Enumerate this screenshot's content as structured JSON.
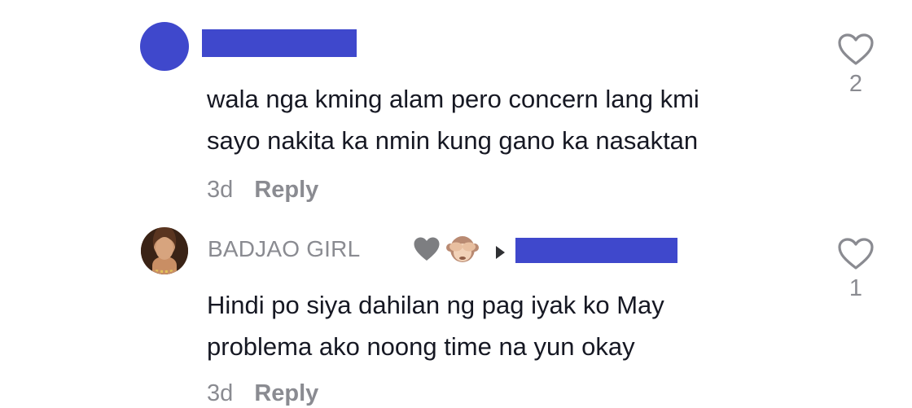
{
  "comments": [
    {
      "avatar": "blue-circle-avatar",
      "username_redacted": true,
      "text_lines": [
        "wala nga kming alam pero concern lang kmi",
        "sayo nakita ka nmin kung gano ka nasaktan"
      ],
      "time": "3d",
      "reply_label": "Reply",
      "like_count": "2",
      "like_icon": "heart-outline-icon"
    },
    {
      "avatar": "profile-photo-avatar",
      "username": "BADJAO GIRL",
      "badges": [
        "grey-heart-emoji",
        "see-no-evil-monkey-emoji"
      ],
      "reply_to_icon": "triangle-right-icon",
      "reply_to_redacted": true,
      "text_lines": [
        "Hindi po siya dahilan ng pag iyak ko May",
        "problema ako noong time na yun okay"
      ],
      "time": "3d",
      "reply_label": "Reply",
      "like_count": "1",
      "like_icon": "heart-outline-icon"
    }
  ],
  "colors": {
    "redaction": "#3f48cc",
    "secondary_text": "#8a8b91",
    "primary_text": "#161823"
  }
}
